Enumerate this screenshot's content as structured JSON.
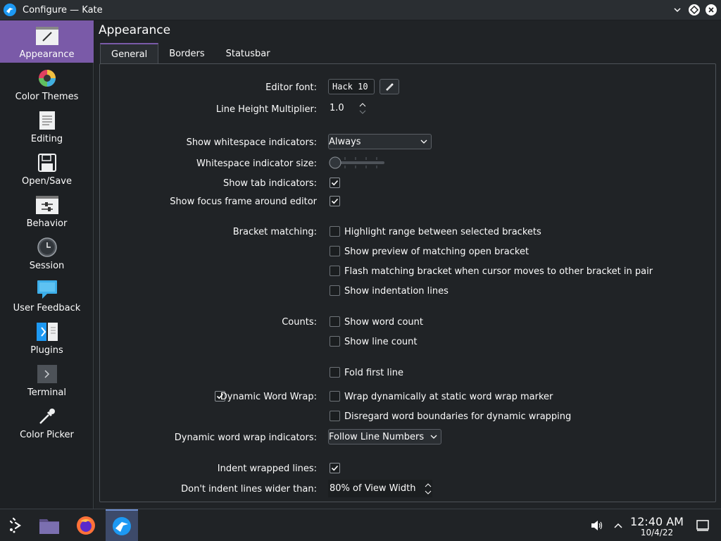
{
  "window": {
    "title": "Configure — Kate"
  },
  "sidebar": {
    "items": [
      {
        "label": "Appearance",
        "icon": "paintbrush-icon",
        "active": true
      },
      {
        "label": "Color Themes",
        "icon": "color-wheel-icon"
      },
      {
        "label": "Editing",
        "icon": "document-icon"
      },
      {
        "label": "Open/Save",
        "icon": "floppy-disk-icon"
      },
      {
        "label": "Behavior",
        "icon": "sliders-icon"
      },
      {
        "label": "Session",
        "icon": "clock-icon"
      },
      {
        "label": "User Feedback",
        "icon": "speech-bubble-icon"
      },
      {
        "label": "Plugins",
        "icon": "plugin-icon"
      },
      {
        "label": "Terminal",
        "icon": "terminal-icon"
      },
      {
        "label": "Color Picker",
        "icon": "eyedropper-icon"
      }
    ]
  },
  "page": {
    "title": "Appearance",
    "tabs": [
      "General",
      "Borders",
      "Statusbar"
    ],
    "active_tab": "General"
  },
  "form": {
    "editor_font_label": "Editor font:",
    "editor_font_value": "Hack 10",
    "line_height_label": "Line Height Multiplier:",
    "line_height_value": "1.0",
    "whitespace_label": "Show whitespace indicators:",
    "whitespace_value": "Always",
    "whitespace_size_label": "Whitespace indicator size:",
    "whitespace_size_level": 0,
    "tab_indicators_label": "Show tab indicators:",
    "tab_indicators_checked": true,
    "focus_frame_label": "Show focus frame around editor",
    "focus_frame_checked": true,
    "bracket_label": "Bracket matching:",
    "bracket_options": [
      {
        "label": "Highlight range between selected brackets",
        "checked": false
      },
      {
        "label": "Show preview of matching open bracket",
        "checked": false
      },
      {
        "label": "Flash matching bracket when cursor moves to other bracket in pair",
        "checked": false
      },
      {
        "label": "Show indentation lines",
        "checked": false
      }
    ],
    "counts_label": "Counts:",
    "counts_options": [
      {
        "label": "Show word count",
        "checked": false
      },
      {
        "label": "Show line count",
        "checked": false
      }
    ],
    "fold_first_line": {
      "label": "Fold first line",
      "checked": false
    },
    "dynamic_wrap_label": "Dynamic Word Wrap:",
    "dynamic_wrap_checked": true,
    "wrap_options": [
      {
        "label": "Wrap dynamically at static word wrap marker",
        "checked": false
      },
      {
        "label": "Disregard word boundaries for dynamic wrapping",
        "checked": false
      }
    ],
    "wrap_indicators_label": "Dynamic word wrap indicators:",
    "wrap_indicators_value": "Follow Line Numbers",
    "indent_wrapped_label": "Indent wrapped lines:",
    "indent_wrapped_checked": true,
    "dont_indent_label": "Don't indent lines wider than:",
    "dont_indent_value": "80% of View Width"
  },
  "taskbar": {
    "items": [
      "app-launcher-icon",
      "file-manager-icon",
      "firefox-icon",
      "kate-icon"
    ],
    "active": "kate-icon",
    "time": "12:40 AM",
    "date": "10/4/22"
  },
  "colors": {
    "accent": "#7a5aa8",
    "background": "#202326",
    "sidebar_bg": "#1d2023"
  }
}
